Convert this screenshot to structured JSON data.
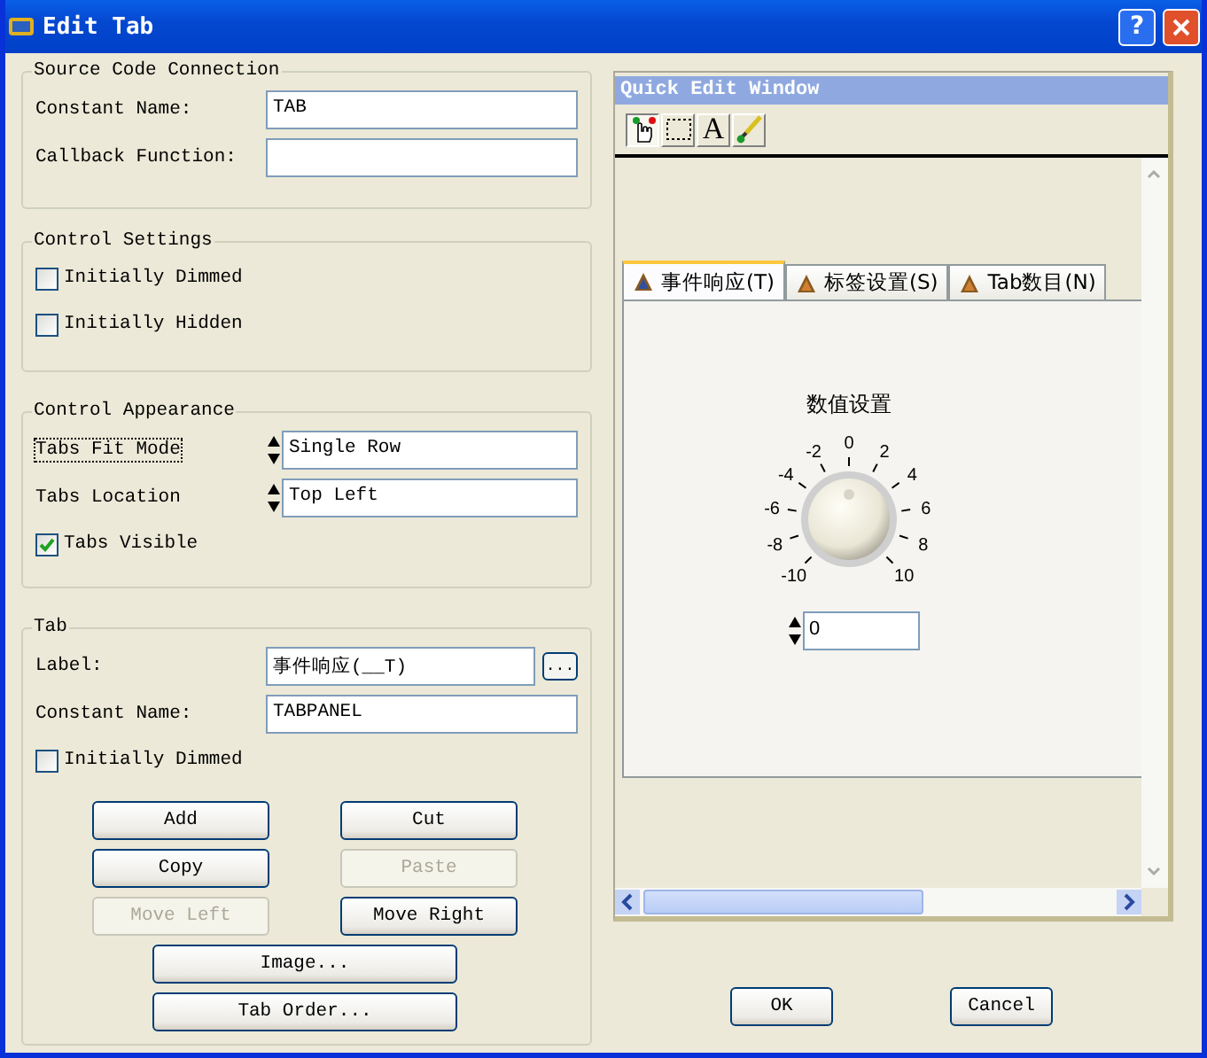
{
  "window": {
    "title": "Edit Tab",
    "help": "?"
  },
  "source_code": {
    "title": "Source Code Connection",
    "fields": [
      {
        "label": "Constant Name:",
        "value": "TAB"
      },
      {
        "label": "Callback Function:"
      }
    ]
  },
  "control_settings": {
    "title": "Control Settings",
    "checkboxes": [
      {
        "label": "Initially Dimmed",
        "checked": false
      },
      {
        "label": "Initially Hidden",
        "checked": false
      }
    ]
  },
  "control_appearance": {
    "title": "Control Appearance",
    "rows": [
      {
        "kind": "ring",
        "label": "Tabs Fit Mode",
        "value": "Single Row",
        "focused": true
      },
      {
        "kind": "ring",
        "label": "Tabs Location",
        "value": "Top Left",
        "focused": false
      },
      {
        "kind": "checkbox",
        "label": "Tabs Visible",
        "checked": true
      }
    ]
  },
  "tab": {
    "title": "Tab",
    "fields": [
      {
        "label": "Label:",
        "value": "事件响应(__T)",
        "browse": "..."
      },
      {
        "label": "Constant Name:",
        "value": "TABPANEL"
      }
    ],
    "checkbox": {
      "label": "Initially Dimmed",
      "checked": false
    },
    "buttons": [
      {
        "kind": "small",
        "label": "Add",
        "disabled": false
      },
      {
        "kind": "small",
        "label": "Cut",
        "disabled": false
      },
      {
        "kind": "small",
        "label": "Copy",
        "disabled": false
      },
      {
        "kind": "small",
        "label": "Paste",
        "disabled": true
      },
      {
        "kind": "small",
        "label": "Move Left",
        "disabled": true
      },
      {
        "kind": "small",
        "label": "Move Right",
        "disabled": false
      },
      {
        "kind": "wide",
        "label": "Image...",
        "disabled": false
      },
      {
        "kind": "wide",
        "label": "Tab Order...",
        "disabled": false
      }
    ]
  },
  "quick_edit": {
    "title": "Quick Edit Window",
    "tools": [
      {
        "kind": "operate",
        "selected": true
      },
      {
        "kind": "select",
        "selected": false
      },
      {
        "kind": "text",
        "label": "A",
        "selected": false
      },
      {
        "kind": "color",
        "selected": false
      }
    ],
    "tabs": [
      {
        "label": "事件响应(T)",
        "selected": true
      },
      {
        "label": "标签设置(S)",
        "selected": false
      },
      {
        "label": "Tab数目(N)",
        "selected": false
      }
    ],
    "dial": {
      "label": "数值设置",
      "ticks": [
        "-10",
        "-8",
        "-6",
        "-4",
        "-2",
        "0",
        "2",
        "4",
        "6",
        "8",
        "10"
      ],
      "level": 0.5,
      "value": "0"
    }
  },
  "buttons": [
    {
      "label": "OK"
    },
    {
      "label": "Cancel"
    }
  ]
}
